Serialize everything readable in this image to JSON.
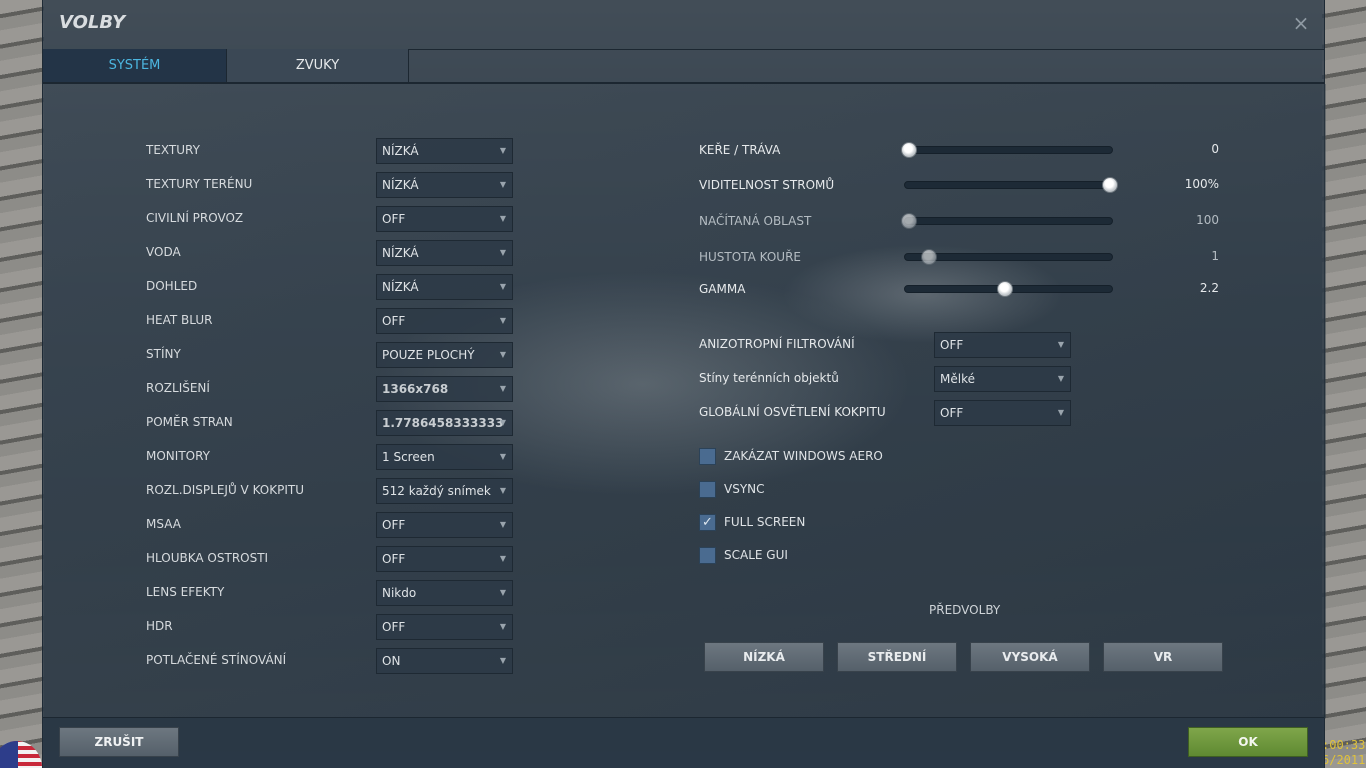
{
  "window": {
    "title": "VOLBY",
    "close_symbol": "×"
  },
  "tabs": [
    {
      "label": "SYSTÉM",
      "active": true
    },
    {
      "label": "ZVUKY",
      "active": false
    }
  ],
  "left_settings": [
    {
      "label": "TEXTURY",
      "value": "NÍZKÁ"
    },
    {
      "label": "TEXTURY TERÉNU",
      "value": "NÍZKÁ"
    },
    {
      "label": "CIVILNÍ PROVOZ",
      "value": "OFF"
    },
    {
      "label": "VODA",
      "value": "NÍZKÁ"
    },
    {
      "label": "DOHLED",
      "value": "NÍZKÁ"
    },
    {
      "label": "HEAT BLUR",
      "value": "OFF"
    },
    {
      "label": "STÍNY",
      "value": "POUZE PLOCHÝ"
    },
    {
      "label": "ROZLIŠENÍ",
      "value": "1366x768"
    },
    {
      "label": "POMĚR STRAN",
      "value": "1.7786458333333"
    },
    {
      "label": "MONITORY",
      "value": "1 Screen"
    },
    {
      "label": "ROZL.DISPLEJŮ V KOKPITU",
      "value": "512 každý snímek"
    },
    {
      "label": "MSAA",
      "value": "OFF"
    },
    {
      "label": "HLOUBKA OSTROSTI",
      "value": "OFF"
    },
    {
      "label": "LENS EFEKTY",
      "value": "Nikdo"
    },
    {
      "label": "HDR",
      "value": "OFF"
    },
    {
      "label": "POTLAČENÉ STÍNOVÁNÍ",
      "value": "ON"
    }
  ],
  "sliders": [
    {
      "label": "KEŘE / TRÁVA",
      "value": "0",
      "level": 0,
      "enabled": true
    },
    {
      "label": "VIDITELNOST STROMŮ",
      "value": "100%",
      "level": 1,
      "enabled": true
    },
    {
      "label": "NAČÍTANÁ OBLAST",
      "value": "100",
      "level": 0,
      "enabled": false
    },
    {
      "label": "HUSTOTA KOUŘE",
      "value": "1",
      "level": 0.1,
      "enabled": false
    },
    {
      "label": "GAMMA",
      "value": "2.2",
      "level": 0.48,
      "enabled": true
    }
  ],
  "right_selects": [
    {
      "label": "ANIZOTROPNÍ  FILTROVÁNÍ",
      "value": "OFF"
    },
    {
      "label": "Stíny terénních objektů",
      "value": "Mělké"
    },
    {
      "label": "GLOBÁLNÍ OSVĚTLENÍ KOKPITU",
      "value": "OFF"
    }
  ],
  "checkboxes": [
    {
      "label": "ZAKÁZAT WINDOWS AERO",
      "checked": false
    },
    {
      "label": "VSYNC",
      "checked": false
    },
    {
      "label": "FULL SCREEN",
      "checked": true
    },
    {
      "label": "SCALE GUI",
      "checked": false
    }
  ],
  "presets": {
    "label": "PŘEDVOLBY",
    "buttons": [
      "NÍZKÁ",
      "STŘEDNÍ",
      "VYSOKÁ",
      "VR"
    ]
  },
  "footer": {
    "cancel_label": "ZRUŠIT",
    "ok_label": "OK"
  },
  "background_overlay": {
    "clock_time": ":00:33",
    "clock_date": "6/2011"
  },
  "colors": {
    "accent_tab": "#4cb6e0",
    "ok_button": "#6f9a3e",
    "checkbox": "#4a6b90"
  },
  "icons": {
    "close": "close-icon",
    "dropdown": "chevron-down-icon",
    "check": "checkmark-icon",
    "flag": "us-flag-icon"
  }
}
